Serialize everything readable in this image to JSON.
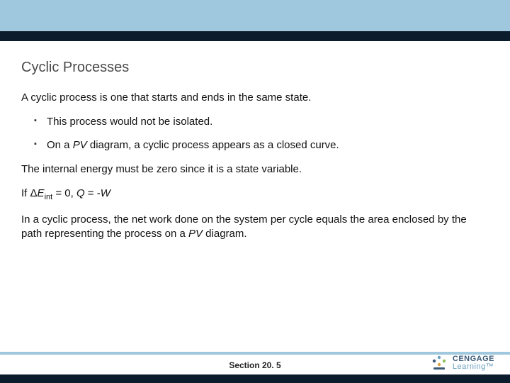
{
  "title": "Cyclic Processes",
  "body": {
    "p1": "A cyclic process is one that starts and ends in the same state.",
    "b1": "This process would not be isolated.",
    "b2_pre": "On a ",
    "b2_pv": "PV",
    "b2_post": " diagram, a cyclic process appears as a closed curve.",
    "p2": "The internal energy must be zero since it is a state variable.",
    "p3_pre": "If ",
    "p3_delta": "Δ",
    "p3_eint_e": "E",
    "p3_eint_sub": "int",
    "p3_mid": " = 0, ",
    "p3_q": "Q",
    "p3_eq": " = -",
    "p3_w": "W",
    "p4_pre": "In a cyclic process, the net work done on the system per cycle equals the area enclosed by the path representing the process on a ",
    "p4_pv": "PV",
    "p4_post": " diagram."
  },
  "footer": {
    "section": "Section  20. 5",
    "logo1": "CENGAGE",
    "logo2": "Learning™"
  }
}
